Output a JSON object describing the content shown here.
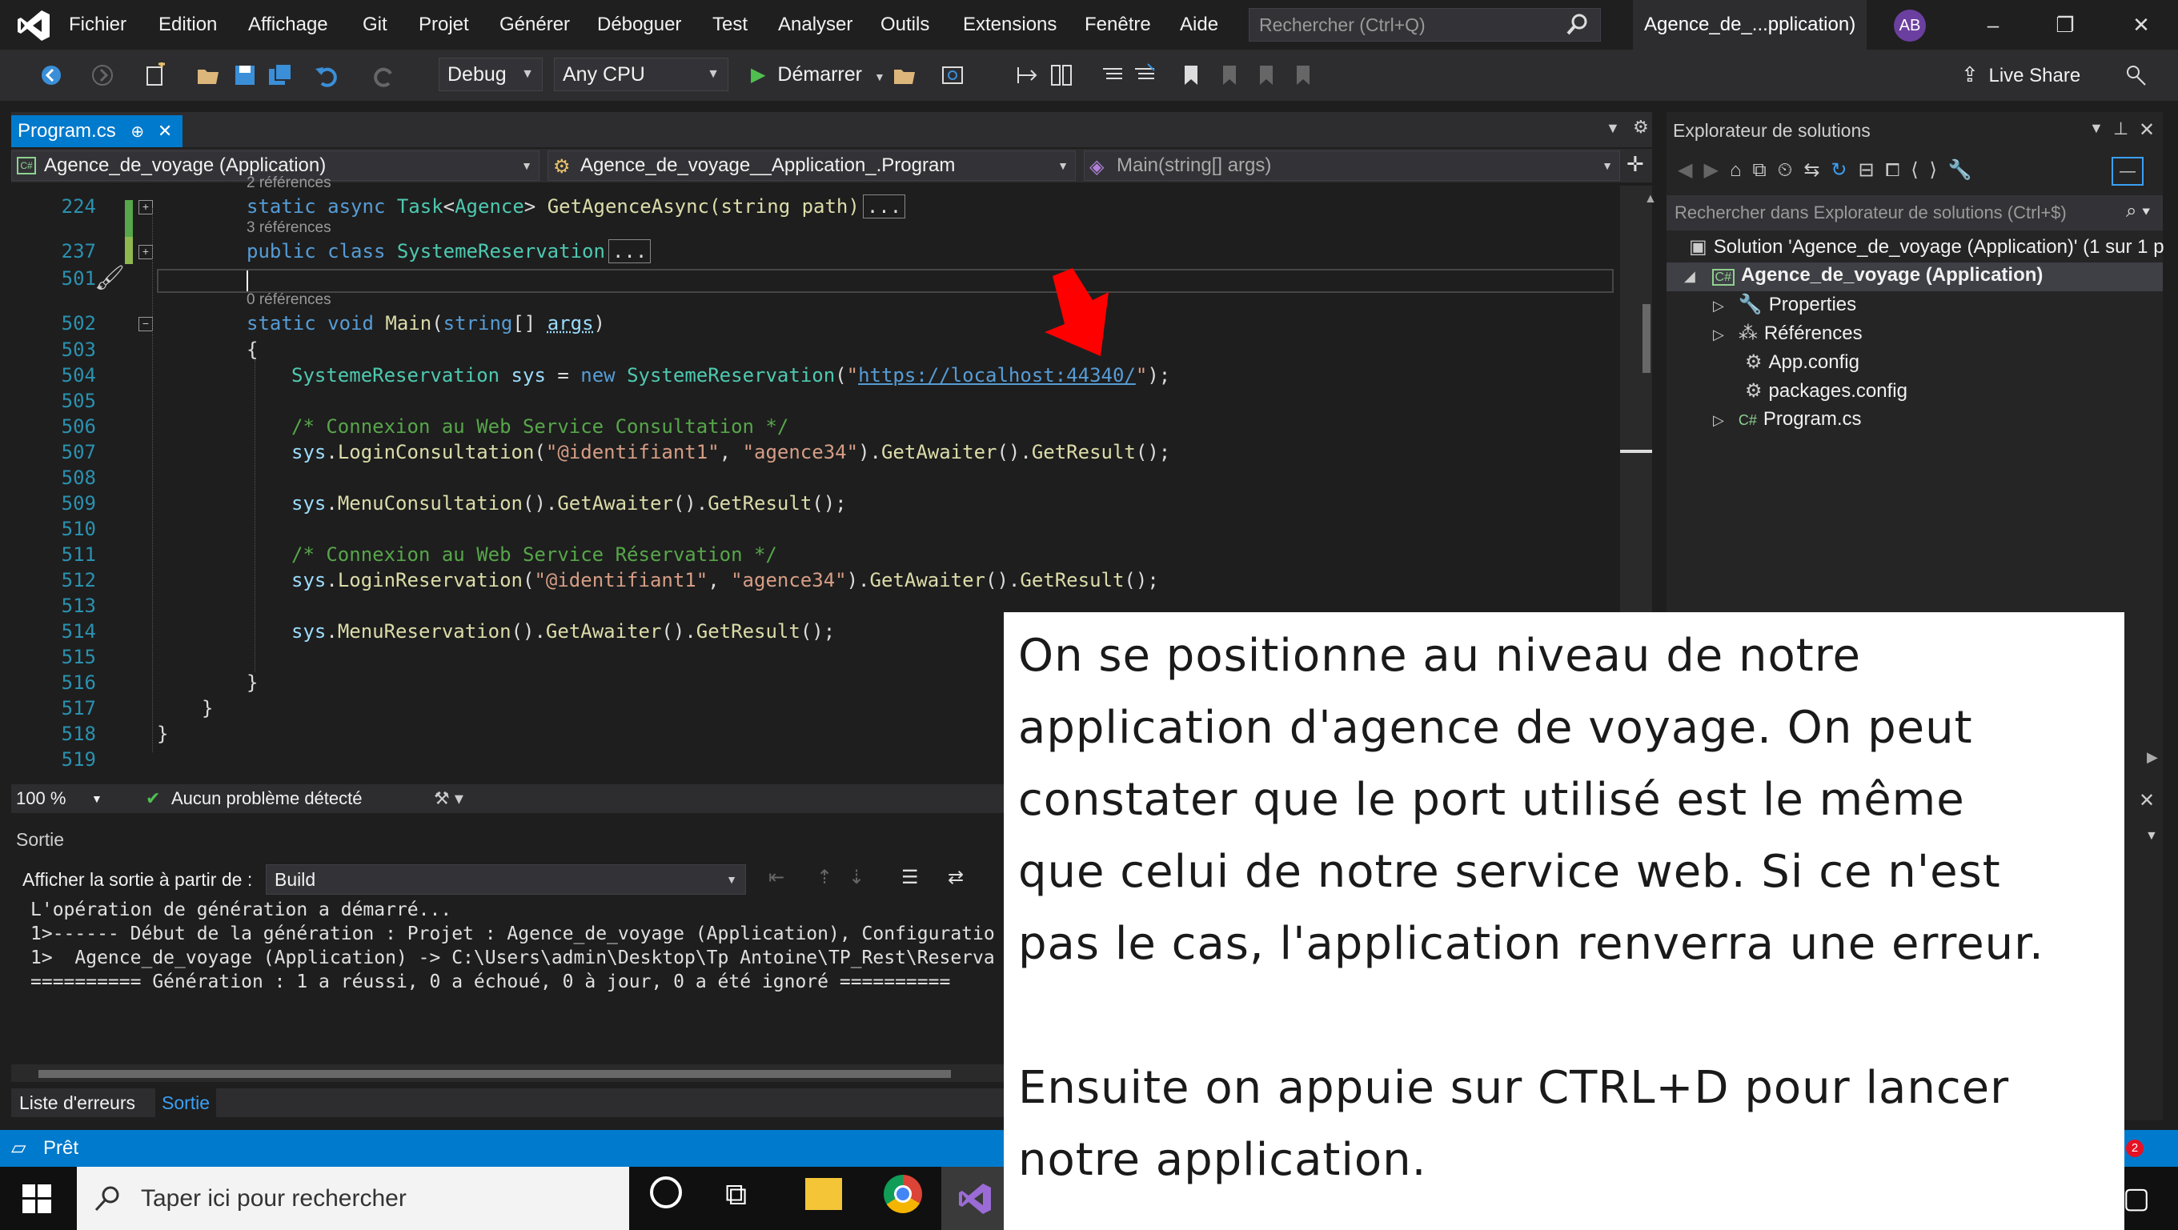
{
  "menu": [
    "Fichier",
    "Edition",
    "Affichage",
    "Git",
    "Projet",
    "Générer",
    "Déboguer",
    "Test",
    "Analyser",
    "Outils",
    "Extensions",
    "Fenêtre",
    "Aide"
  ],
  "search": {
    "placeholder": "Rechercher (Ctrl+Q)"
  },
  "solution_short": "Agence_de_...pplication)",
  "avatar": "AB",
  "toolbar": {
    "config": "Debug",
    "platform": "Any CPU",
    "start": "Démarrer",
    "live_share": "Live Share"
  },
  "editor": {
    "tab": "Program.cs",
    "nav": [
      "Agence_de_voyage (Application)",
      "Agence_de_voyage__Application_.Program",
      "Main(string[] args)"
    ],
    "lines": [
      {
        "n": "224",
        "refs": "2 références"
      },
      {
        "n": "237",
        "refs": "3 références"
      },
      {
        "n": "501"
      },
      {
        "n": "502",
        "refs": "0 références"
      },
      {
        "n": "503"
      },
      {
        "n": "504"
      },
      {
        "n": "505"
      },
      {
        "n": "506"
      },
      {
        "n": "507"
      },
      {
        "n": "508"
      },
      {
        "n": "509"
      },
      {
        "n": "510"
      },
      {
        "n": "511"
      },
      {
        "n": "512"
      },
      {
        "n": "513"
      },
      {
        "n": "514"
      },
      {
        "n": "515"
      },
      {
        "n": "516"
      },
      {
        "n": "517"
      },
      {
        "n": "518"
      },
      {
        "n": "519"
      }
    ],
    "code": {
      "l224": "GetAgenceAsync(string path)",
      "l237": "SystemeReservation",
      "url": "https://localhost:44340/",
      "comment1": "/* Connexion au Web Service Consultation */",
      "comment2": "/* Connexion au Web Service Réservation */",
      "login_user": "\"@identifiant1\"",
      "login_pwd": "\"agence34\""
    },
    "zoom": "100 %",
    "problems": "Aucun problème détecté"
  },
  "output": {
    "title": "Sortie",
    "show_from_label": "Afficher la sortie à partir de :",
    "source": "Build",
    "lines": [
      "L'opération de génération a démarré...",
      "1>------ Début de la génération : Projet : Agence_de_voyage (Application), Configuratio",
      "1>  Agence_de_voyage (Application) -> C:\\Users\\admin\\Desktop\\Tp Antoine\\TP_Rest\\Reserva",
      "========== Génération : 1 a réussi, 0 a échoué, 0 à jour, 0 a été ignoré =========="
    ],
    "tabs": [
      "Liste d'erreurs",
      "Sortie"
    ]
  },
  "status": "Prêt",
  "solution_explorer": {
    "title": "Explorateur de solutions",
    "search": "Rechercher dans Explorateur de solutions (Ctrl+$)",
    "solution": "Solution 'Agence_de_voyage (Application)' (1 sur 1 p",
    "project": "Agence_de_voyage (Application)",
    "items": [
      "Properties",
      "Références",
      "App.config",
      "packages.config",
      "Program.cs"
    ]
  },
  "taskbar": {
    "search": "Taper ici pour rechercher",
    "badge": "2"
  },
  "overlay": {
    "p1": [
      "On se positionne au niveau de notre",
      "application d'agence de voyage. On peut",
      "constater que le port utilisé est le même",
      "que celui de notre service web. Si ce n'est",
      "pas le cas, l'application renverra une erreur."
    ],
    "p2": [
      "Ensuite on appuie sur CTRL+D pour lancer",
      "notre application."
    ]
  },
  "colors": {
    "accent": "#007acc",
    "annotation_arrow": "#ff0000"
  }
}
